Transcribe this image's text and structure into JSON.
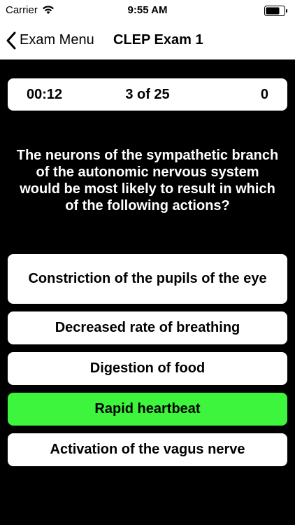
{
  "status_bar": {
    "carrier": "Carrier",
    "time": "9:55 AM"
  },
  "nav": {
    "back_label": "Exam Menu",
    "title": "CLEP Exam 1"
  },
  "score_card": {
    "timer": "00:12",
    "progress": "3 of 25",
    "score": "0"
  },
  "question": "The neurons of the sympathetic branch of the autonomic nervous system would be most likely to result in which of the following actions?",
  "answers": [
    {
      "label": "Constriction of the pupils of the eye",
      "state": "default"
    },
    {
      "label": "Decreased rate of breathing",
      "state": "default"
    },
    {
      "label": "Digestion of food",
      "state": "default"
    },
    {
      "label": "Rapid heartbeat",
      "state": "correct"
    },
    {
      "label": "Activation of the vagus nerve",
      "state": "default"
    }
  ],
  "colors": {
    "background": "#000000",
    "card": "#ffffff",
    "correct": "#3cf53c"
  }
}
